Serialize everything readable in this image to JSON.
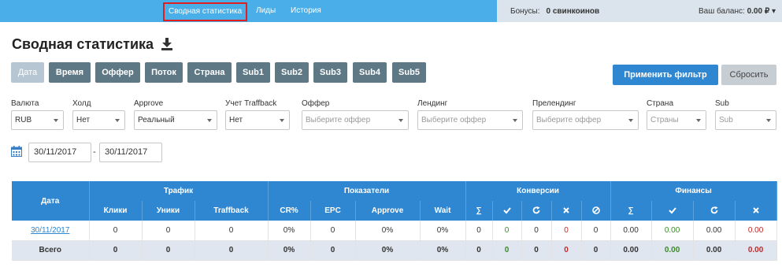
{
  "topnav": {
    "items": [
      "Сводная статистика",
      "Лиды",
      "История"
    ],
    "bonus_label": "Бонусы:",
    "bonus_value": "0 свинкоинов",
    "balance_label": "Ваш баланс:",
    "balance_value": "0.00 ₽"
  },
  "page": {
    "title": "Сводная статистика"
  },
  "group_buttons": [
    "Дата",
    "Время",
    "Оффер",
    "Поток",
    "Страна",
    "Sub1",
    "Sub2",
    "Sub3",
    "Sub4",
    "Sub5"
  ],
  "actions": {
    "apply": "Применить фильтр",
    "reset": "Сбросить"
  },
  "filters": {
    "currency": {
      "label": "Валюта",
      "value": "RUB"
    },
    "hold": {
      "label": "Холд",
      "value": "Нет"
    },
    "approve": {
      "label": "Approve",
      "value": "Реальный"
    },
    "traffback": {
      "label": "Учет Traffback",
      "value": "Нет"
    },
    "offer": {
      "label": "Оффер",
      "placeholder": "Выберите оффер"
    },
    "landing": {
      "label": "Лендинг",
      "placeholder": "Выберите оффер"
    },
    "prelanding": {
      "label": "Прелендинг",
      "placeholder": "Выберите оффер"
    },
    "country": {
      "label": "Страна",
      "placeholder": "Страны"
    },
    "sub": {
      "label": "Sub",
      "placeholder": "Sub"
    }
  },
  "dates": {
    "from": "30/11/2017",
    "separator": "-",
    "to": "30/11/2017"
  },
  "table": {
    "date_header": "Дата",
    "groups": [
      "Трафик",
      "Показатели",
      "Конверсии",
      "Финансы"
    ],
    "sub_headers": [
      "Клики",
      "Уники",
      "Traffback",
      "CR%",
      "EPC",
      "Approve",
      "Wait",
      "∑",
      "∑"
    ],
    "rows": [
      {
        "date": "30/11/2017",
        "cells": [
          "0",
          "0",
          "0",
          "0%",
          "0",
          "0%",
          "0%",
          "0",
          "0",
          "0",
          "0",
          "0",
          "0.00",
          "0.00",
          "0.00",
          "0.00"
        ]
      }
    ],
    "total": {
      "label": "Всего",
      "cells": [
        "0",
        "0",
        "0",
        "0%",
        "0",
        "0%",
        "0%",
        "0",
        "0",
        "0",
        "0",
        "0",
        "0.00",
        "0.00",
        "0.00",
        "0.00"
      ]
    }
  },
  "colors": {
    "topbar": "#4aaee8",
    "table_header": "#2f86d1",
    "green": "#3a8a2a",
    "red": "#c0292b"
  }
}
